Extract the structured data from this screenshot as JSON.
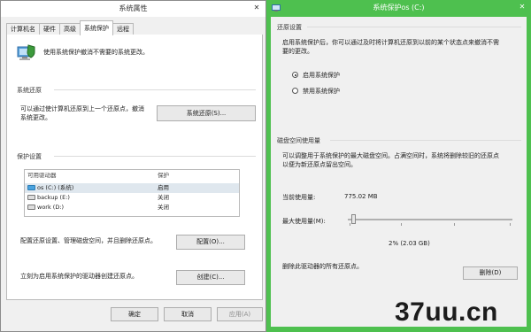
{
  "left_window": {
    "title": "系统属性",
    "tabs": [
      "计算机名",
      "硬件",
      "高级",
      "系统保护",
      "远程"
    ],
    "intro_text": "使用系统保护撤消不需要的系统更改。",
    "system_restore": {
      "heading": "系统还原",
      "description_line1": "可以通过使计算机还原到上一个还原点，撤消",
      "description_line2": "系统更改。",
      "button_label": "系统还原(S)..."
    },
    "protection": {
      "heading": "保护设置",
      "columns": [
        "可用驱动器",
        "保护"
      ],
      "drives": [
        {
          "name": "os (C:) (系统)",
          "status": "启用"
        },
        {
          "name": "backup (E:)",
          "status": "关闭"
        },
        {
          "name": "work (D:)",
          "status": "关闭"
        }
      ],
      "configure_text": "配置还原设置、管理磁盘空间，并且删除还原点。",
      "configure_button": "配置(O)...",
      "create_text": "立刻为启用系统保护的驱动器创建还原点。",
      "create_button": "创建(C)..."
    },
    "footer": {
      "ok": "确定",
      "cancel": "取消",
      "apply": "应用(A)"
    }
  },
  "right_window": {
    "title": "系统保护os (C:)",
    "restore_settings": {
      "heading": "还原设置",
      "description_line1": "启用系统保护后，你可以通过及时将计算机还原到以前的某个状态点来撤消不需",
      "description_line2": "要的更改。",
      "options": [
        "启用系统保护",
        "禁用系统保护"
      ],
      "selected": "启用系统保护"
    },
    "disk_usage": {
      "heading": "磁盘空间使用量",
      "description_line1": "可以调整用于系统保护的最大磁盘空间。占满空间时，系统将删除较旧的还原点",
      "description_line2": "以便为新还原点留出空间。",
      "current_label": "当前使用量:",
      "current_value": "775.02 MB",
      "max_label": "最大使用量(M):",
      "max_fraction": 0.02,
      "max_value_text": "2% (2.03 GB)",
      "delete_text": "删除此驱动器的所有还原点。",
      "delete_button": "删除(D)"
    }
  },
  "watermark": "37uu.cn",
  "colors": {
    "accent_green": "#4ec04f"
  }
}
